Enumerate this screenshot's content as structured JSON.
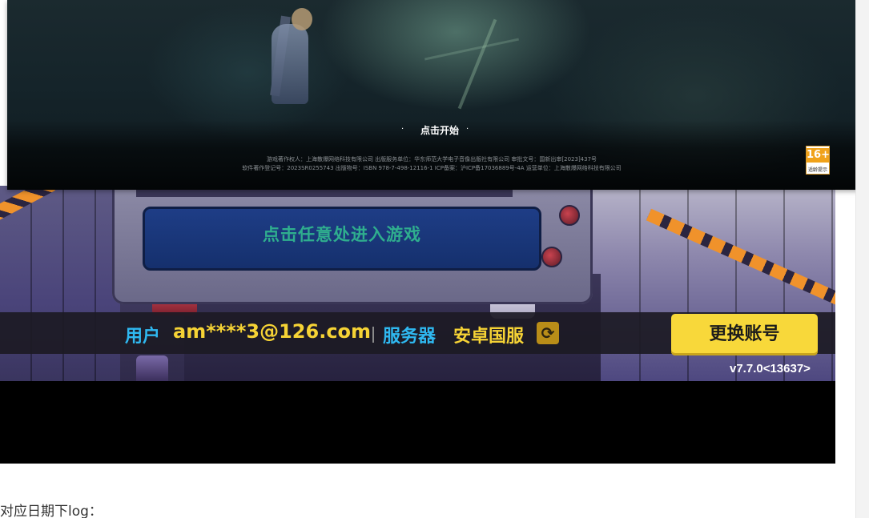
{
  "game_top": {
    "tap_to_start": "点击开始",
    "legal_line_1": "游戏著作权人：上海散爆网络科技有限公司 出版服务单位：华东师范大学电子音像出版社有限公司 审批文号：国新出审[2023]437号",
    "legal_line_2": "软件著作登记号：2023SR0255743 出版物号：ISBN 978-7-498-12116-1 ICP备案：沪ICP备17036889号-4A 运营单位：上海散爆网络科技有限公司",
    "age_rating": {
      "number": "16+",
      "label": "适龄提示"
    }
  },
  "game_bottom": {
    "enter_game": "点击任意处进入游戏",
    "user_label": "用户",
    "user_value": "am****3@126.com",
    "server_label": "服务器",
    "server_value": "安卓国服",
    "switch_account": "更换账号",
    "version": "v7.7.0<13637>"
  },
  "caption": "对应日期下log："
}
